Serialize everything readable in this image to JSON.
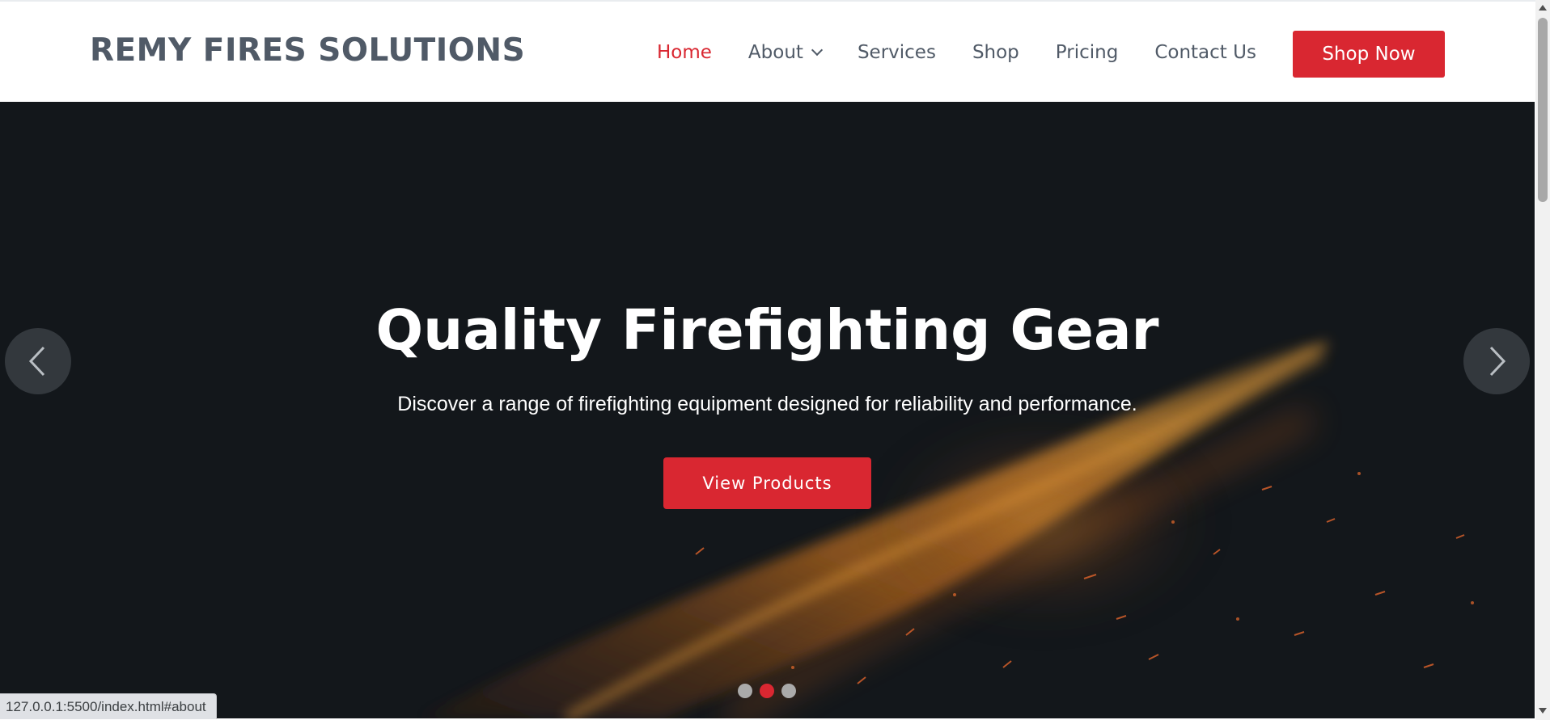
{
  "header": {
    "brand": "REMY FIRES SOLUTIONS",
    "nav": [
      {
        "label": "Home",
        "active": true
      },
      {
        "label": "About",
        "dropdown": true
      },
      {
        "label": "Services"
      },
      {
        "label": "Shop"
      },
      {
        "label": "Pricing"
      },
      {
        "label": "Contact Us"
      }
    ],
    "cta_label": "Shop Now"
  },
  "hero": {
    "title": "Quality Firefighting Gear",
    "subtitle": "Discover a range of firefighting equipment designed for reliability and performance.",
    "button_label": "View Products",
    "slides_count": 3,
    "active_slide": 2
  },
  "status_bar": {
    "url": "127.0.0.1:5500/index.html#about"
  },
  "colors": {
    "accent": "#d92731",
    "brand_text": "#505a67",
    "hero_bg": "#13171b"
  },
  "icons": {
    "prev": "chevron-left-icon",
    "next": "chevron-right-icon",
    "dropdown": "chevron-down-icon"
  }
}
